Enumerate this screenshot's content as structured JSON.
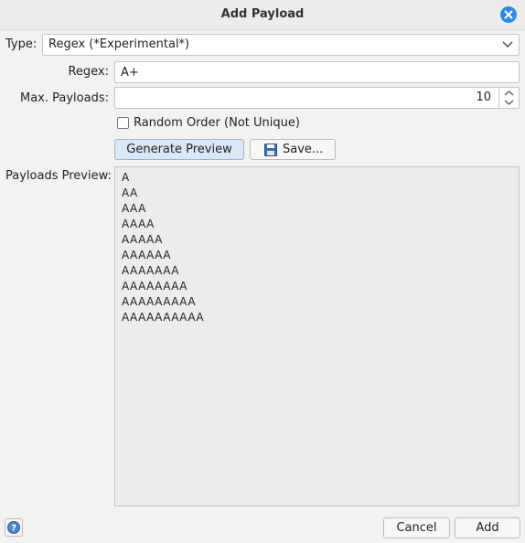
{
  "window": {
    "title": "Add Payload"
  },
  "type": {
    "label": "Type:",
    "value": "Regex (*Experimental*)"
  },
  "regex": {
    "label": "Regex:",
    "value": "A+"
  },
  "max_payloads": {
    "label": "Max. Payloads:",
    "value": "10"
  },
  "random_order": {
    "label": "Random Order (Not Unique)",
    "checked": false
  },
  "buttons": {
    "generate_preview": "Generate Preview",
    "save": "Save...",
    "cancel": "Cancel",
    "add": "Add"
  },
  "preview": {
    "label": "Payloads Preview:",
    "lines": [
      "A",
      "AA",
      "AAA",
      "AAAA",
      "AAAAA",
      "AAAAAA",
      "AAAAAAA",
      "AAAAAAAA",
      "AAAAAAAAA",
      "AAAAAAAAAA"
    ]
  },
  "colors": {
    "accent": "#2b8ae6",
    "primary_button": "#dbe7f5"
  }
}
